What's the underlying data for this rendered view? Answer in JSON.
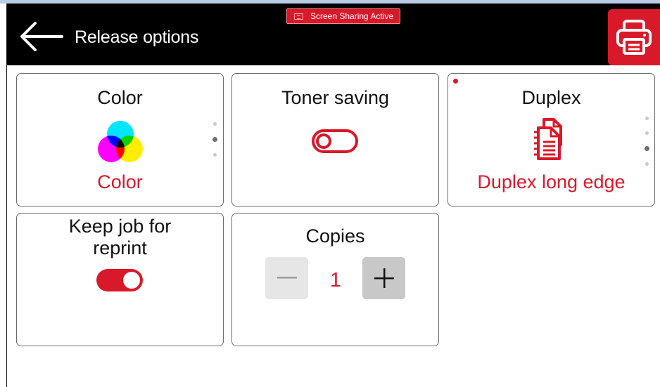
{
  "header": {
    "title": "Release options",
    "screen_sharing_badge": "Screen Sharing Active",
    "back_icon": "arrow-left-icon",
    "print_icon": "printer-icon"
  },
  "options": {
    "color": {
      "title": "Color",
      "value": "Color",
      "icon": "color-cmy-icon",
      "page_indicator": {
        "count": 3,
        "active": 2
      }
    },
    "toner_saving": {
      "title": "Toner saving",
      "enabled": false
    },
    "duplex": {
      "title": "Duplex",
      "value": "Duplex long edge",
      "icon": "duplex-document-icon",
      "changed": true,
      "page_indicator": {
        "count": 4,
        "active": 3
      }
    },
    "keep_job": {
      "title_line1": "Keep job for",
      "title_line2": "reprint",
      "enabled": true
    },
    "copies": {
      "title": "Copies",
      "value": "1",
      "minus_icon": "minus-icon",
      "plus_icon": "plus-icon"
    }
  },
  "colors": {
    "accent": "#d8192a",
    "header_bg": "#000000",
    "tile_border": "#6b6b6b",
    "minus_bg": "#e6e6e6",
    "plus_bg": "#c8c8c8"
  }
}
